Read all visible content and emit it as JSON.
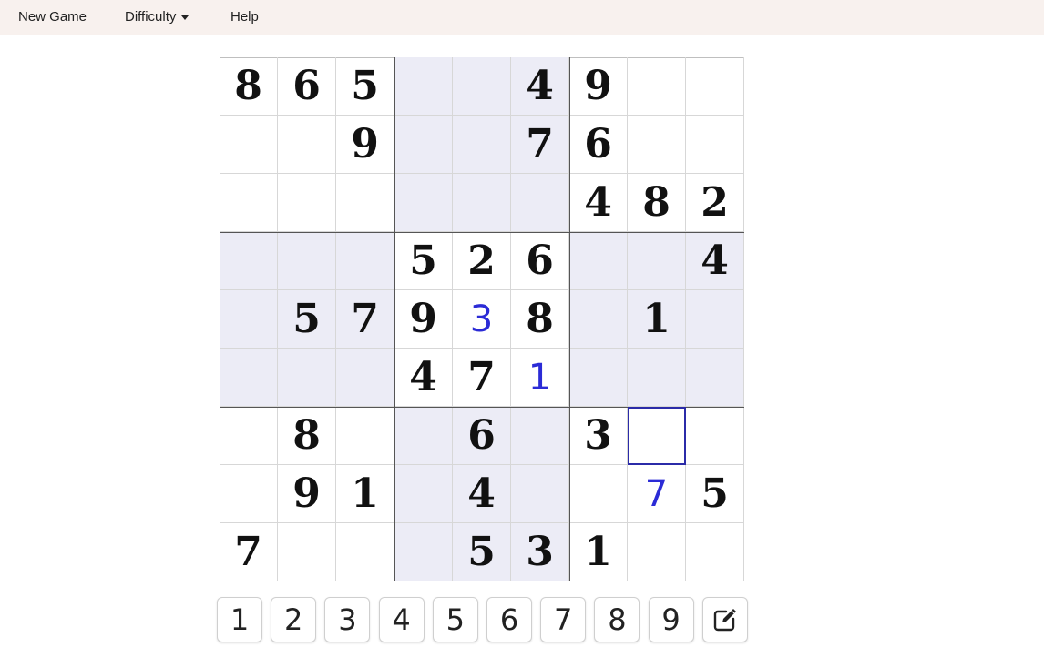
{
  "nav": {
    "new_game": "New Game",
    "difficulty": "Difficulty",
    "help": "Help"
  },
  "board": {
    "rows": [
      [
        "8",
        "6",
        "5",
        "",
        "",
        "4",
        "9",
        "",
        ""
      ],
      [
        "",
        "",
        "9",
        "",
        "",
        "7",
        "6",
        "",
        ""
      ],
      [
        "",
        "",
        "",
        "",
        "",
        "",
        "4",
        "8",
        "2"
      ],
      [
        "",
        "",
        "",
        "5",
        "2",
        "6",
        "",
        "",
        "4"
      ],
      [
        "",
        "5",
        "7",
        "9",
        "3",
        "8",
        "",
        "1",
        ""
      ],
      [
        "",
        "",
        "",
        "4",
        "7",
        "1",
        "",
        "",
        ""
      ],
      [
        "",
        "8",
        "",
        "",
        "6",
        "",
        "3",
        "",
        ""
      ],
      [
        "",
        "9",
        "1",
        "",
        "4",
        "",
        "",
        "7",
        "5"
      ],
      [
        "7",
        "",
        "",
        "",
        "5",
        "3",
        "1",
        "",
        ""
      ]
    ],
    "user_entries": [
      [
        4,
        4
      ],
      [
        5,
        5
      ],
      [
        7,
        7
      ]
    ],
    "selected": [
      6,
      7
    ],
    "shaded_boxes": [
      [
        0,
        1
      ],
      [
        1,
        0
      ],
      [
        1,
        2
      ],
      [
        2,
        1
      ]
    ]
  },
  "numpad": {
    "keys": [
      "1",
      "2",
      "3",
      "4",
      "5",
      "6",
      "7",
      "8",
      "9"
    ],
    "edit_icon": "pencil-edit-icon"
  },
  "colors": {
    "navbar_bg": "#f8f1ee",
    "shade": "#ececf6",
    "user_digit": "#2b2bd6",
    "selection": "#2b2ba8"
  }
}
